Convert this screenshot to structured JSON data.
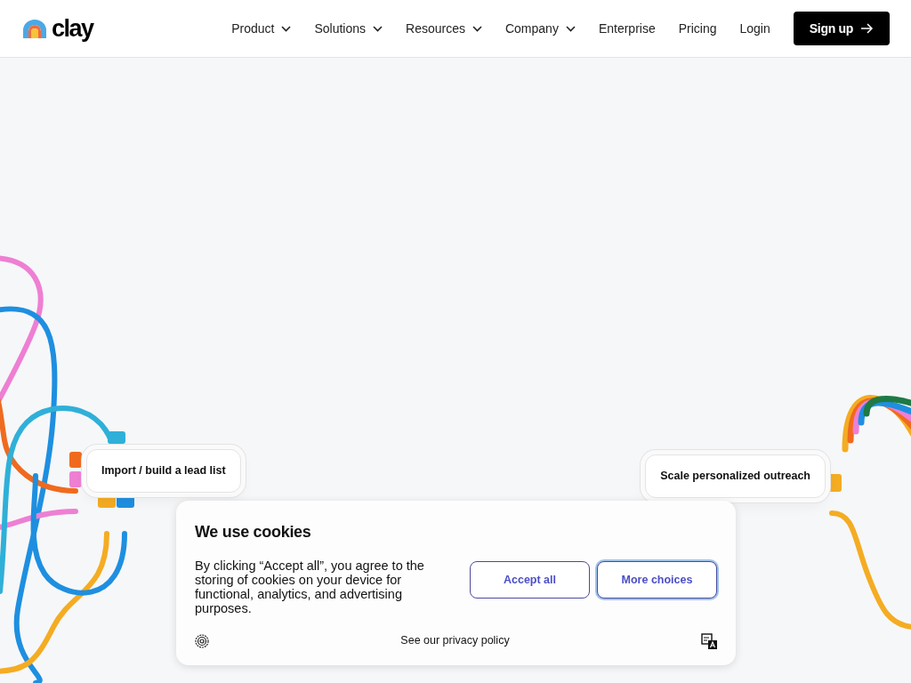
{
  "navbar": {
    "logo": "clay",
    "menu": [
      {
        "label": "Product",
        "dropdown": true
      },
      {
        "label": "Solutions",
        "dropdown": true
      },
      {
        "label": "Resources",
        "dropdown": true
      },
      {
        "label": "Company",
        "dropdown": true
      },
      {
        "label": "Enterprise",
        "dropdown": false
      },
      {
        "label": "Pricing",
        "dropdown": false
      }
    ],
    "login": "Login",
    "signup": "Sign up"
  },
  "nodes": [
    {
      "label": "Import / build a lead list"
    },
    {
      "label": "Scale personalized outreach"
    }
  ],
  "cookie_banner": {
    "title": "We use cookies",
    "text": "By clicking “Accept all”, you agree to the storing of cookies on your device for functional, analytics, and advertising purposes.",
    "buttons": [
      {
        "label": "Accept all",
        "focused": false
      },
      {
        "label": "More choices",
        "focused": true
      }
    ],
    "privacy_link": "See our privacy policy"
  }
}
